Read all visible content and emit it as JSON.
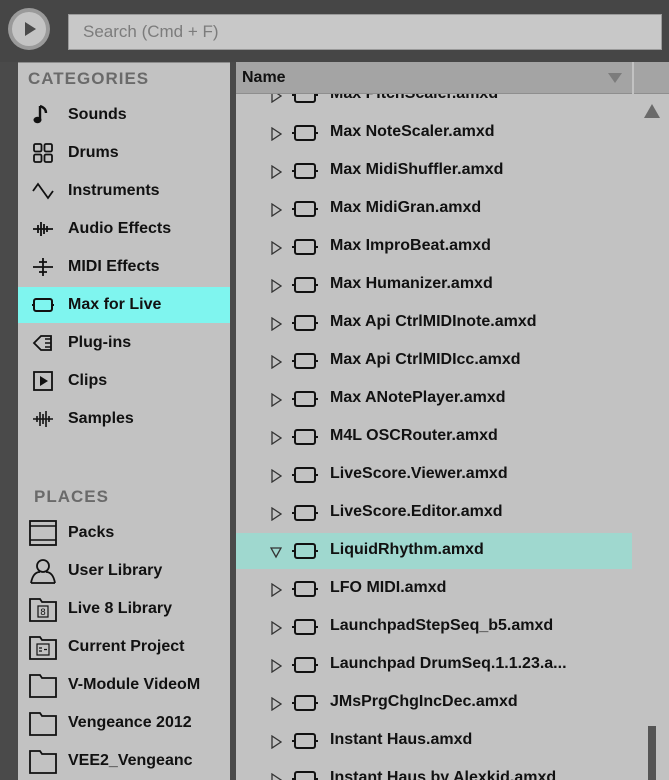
{
  "search": {
    "placeholder": "Search (Cmd + F)"
  },
  "sidebar": {
    "categories_title": "CATEGORIES",
    "categories": [
      {
        "label": "Sounds",
        "icon": "note-icon"
      },
      {
        "label": "Drums",
        "icon": "drum-pads-icon"
      },
      {
        "label": "Instruments",
        "icon": "waveform-icon"
      },
      {
        "label": "Audio Effects",
        "icon": "audio-effect-icon"
      },
      {
        "label": "MIDI Effects",
        "icon": "midi-effect-icon"
      },
      {
        "label": "Max for Live",
        "icon": "max-device-icon",
        "selected": true
      },
      {
        "label": "Plug-ins",
        "icon": "plugin-icon"
      },
      {
        "label": "Clips",
        "icon": "clip-icon"
      },
      {
        "label": "Samples",
        "icon": "sample-icon"
      }
    ],
    "places_title": "PLACES",
    "places": [
      {
        "label": "Packs",
        "icon": "packs-icon"
      },
      {
        "label": "User Library",
        "icon": "user-icon"
      },
      {
        "label": "Live 8 Library",
        "icon": "live8-folder-icon"
      },
      {
        "label": "Current Project",
        "icon": "project-folder-icon"
      },
      {
        "label": "V-Module VideoM",
        "icon": "folder-icon"
      },
      {
        "label": "Vengeance 2012",
        "icon": "folder-icon"
      },
      {
        "label": "VEE2_Vengeanc",
        "icon": "folder-icon"
      }
    ]
  },
  "files": {
    "column_name": "Name",
    "items": [
      {
        "name": "Max PitchScaler.amxd"
      },
      {
        "name": "Max NoteScaler.amxd"
      },
      {
        "name": "Max MidiShuffler.amxd"
      },
      {
        "name": "Max MidiGran.amxd"
      },
      {
        "name": "Max ImproBeat.amxd"
      },
      {
        "name": "Max Humanizer.amxd"
      },
      {
        "name": "Max Api CtrlMIDInote.amxd"
      },
      {
        "name": "Max Api CtrlMIDIcc.amxd"
      },
      {
        "name": "Max ANotePlayer.amxd"
      },
      {
        "name": "M4L OSCRouter.amxd"
      },
      {
        "name": "LiveScore.Viewer.amxd"
      },
      {
        "name": "LiveScore.Editor.amxd"
      },
      {
        "name": "LiquidRhythm.amxd",
        "selected": true,
        "expanded": true
      },
      {
        "name": "LFO MIDI.amxd"
      },
      {
        "name": "LaunchpadStepSeq_b5.amxd"
      },
      {
        "name": "Launchpad DrumSeq.1.1.23.a..."
      },
      {
        "name": "JMsPrgChgIncDec.amxd"
      },
      {
        "name": "Instant Haus.amxd"
      },
      {
        "name": "Instant Haus by Alexkid.amxd"
      }
    ]
  },
  "colors": {
    "selected_category": "#7ff5ef",
    "selected_file": "#9fd8cf",
    "panel_bg": "#c2c2c2"
  }
}
